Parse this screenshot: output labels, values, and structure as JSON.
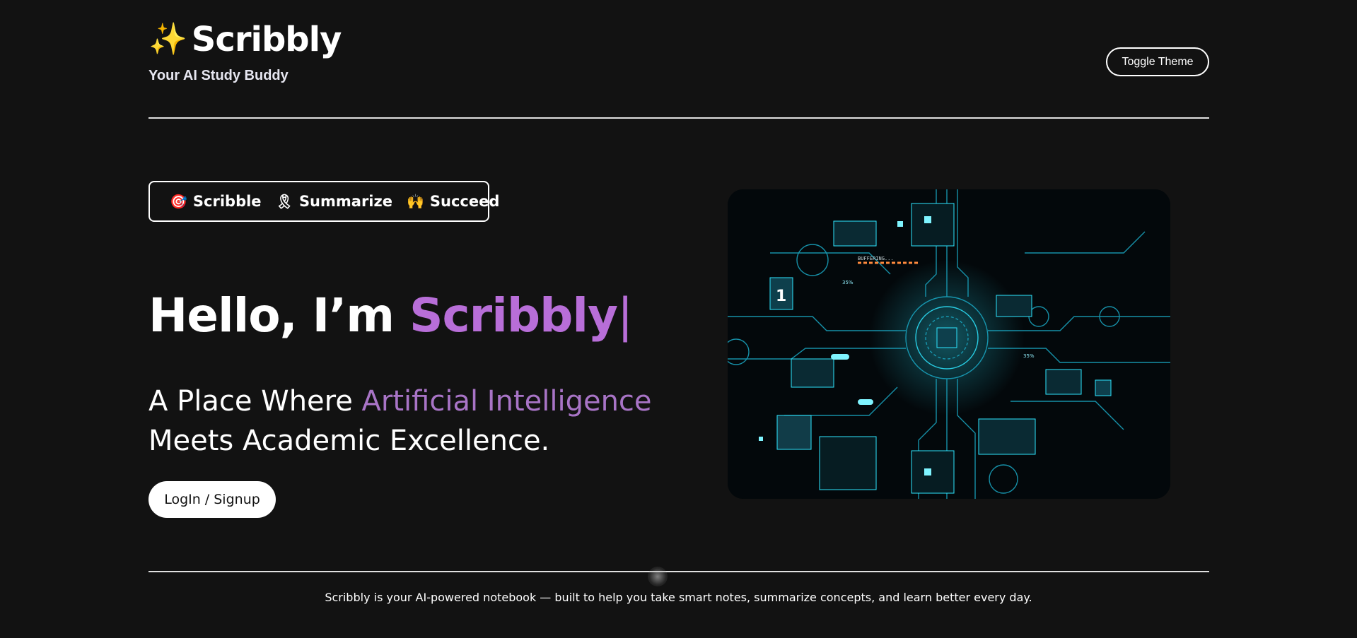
{
  "header": {
    "logo_icon": "sparkle-icon",
    "brand_name": "Scribbly",
    "tagline": "Your AI Study Buddy",
    "theme_toggle_label": "Toggle Theme"
  },
  "pills": [
    {
      "icon": "target-icon",
      "label": "Scribble"
    },
    {
      "icon": "ribbon-icon",
      "label": "Summarize"
    },
    {
      "icon": "people-celebrating-icon",
      "label": "Succeed"
    }
  ],
  "hero": {
    "title_prefix": "Hello, I’m ",
    "title_accent": "Scribbly",
    "title_cursor": "|",
    "subtitle_prefix": "A Place Where ",
    "subtitle_accent": "Artificial Intelligence",
    "subtitle_line2": "Meets Academic Excellence.",
    "cta_label": "LogIn / Signup",
    "image_label": "circuit-board-illustration",
    "image_text": {
      "buffering": "BUFFERING...",
      "chip_number": "1",
      "pct_left": "35%",
      "pct_right": "35%"
    }
  },
  "footer": {
    "text": "Scribbly is your AI-powered notebook — built to help you take smart notes, summarize concepts, and learn better every day."
  },
  "colors": {
    "background": "#121212",
    "accent_purple": "#b86ed8",
    "accent_purple_soft": "#a874c6",
    "circuit_cyan": "#2ee6ff"
  }
}
